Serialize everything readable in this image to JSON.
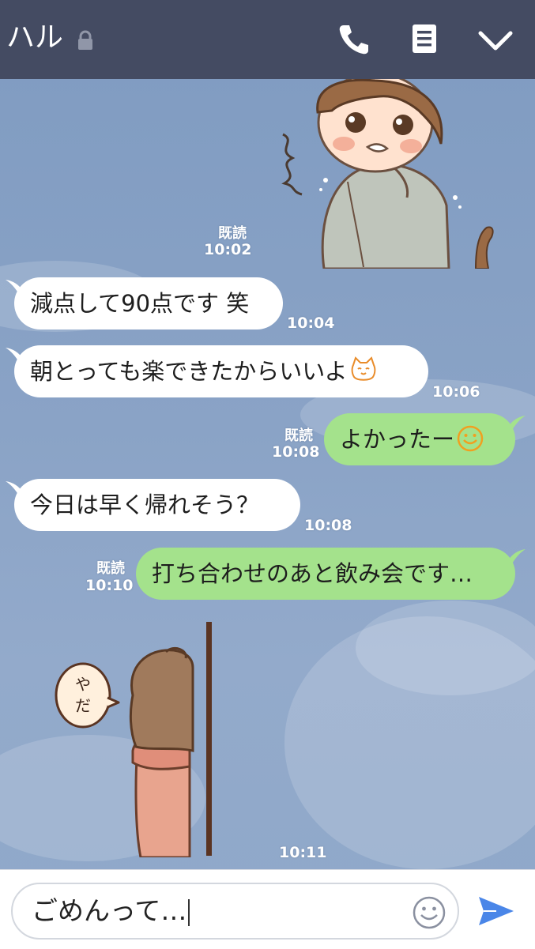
{
  "header": {
    "title": "ハル",
    "icons": [
      "lock-icon",
      "phone-icon",
      "note-icon",
      "chevron-down-icon"
    ],
    "color": "#444b62"
  },
  "chat": {
    "sticker_boy": {
      "read": "既読",
      "time": "10:02"
    },
    "messages": [
      {
        "side": "in",
        "text": "減点して90点です 笑",
        "time": "10:04"
      },
      {
        "side": "in",
        "text": "朝とっても楽できたからいいよ",
        "emoji": "cat-emoji",
        "time": "10:06"
      },
      {
        "side": "out",
        "text": "よかったー",
        "emoji": "smile-emoji",
        "read": "既読",
        "time": "10:08"
      },
      {
        "side": "in",
        "text": "今日は早く帰れそう？",
        "time": "10:08"
      },
      {
        "side": "out",
        "text": "打ち合わせのあと飲み会です…",
        "read": "既読",
        "time": "10:10"
      }
    ],
    "sticker_girl": {
      "speech": "やだ",
      "time": "10:11"
    }
  },
  "input": {
    "value": "ごめんって…",
    "icons": [
      "emoji-icon",
      "send-icon"
    ]
  },
  "colors": {
    "incoming": "#ffffff",
    "outgoing": "#a4e28c",
    "accent": "#4a86e8"
  }
}
